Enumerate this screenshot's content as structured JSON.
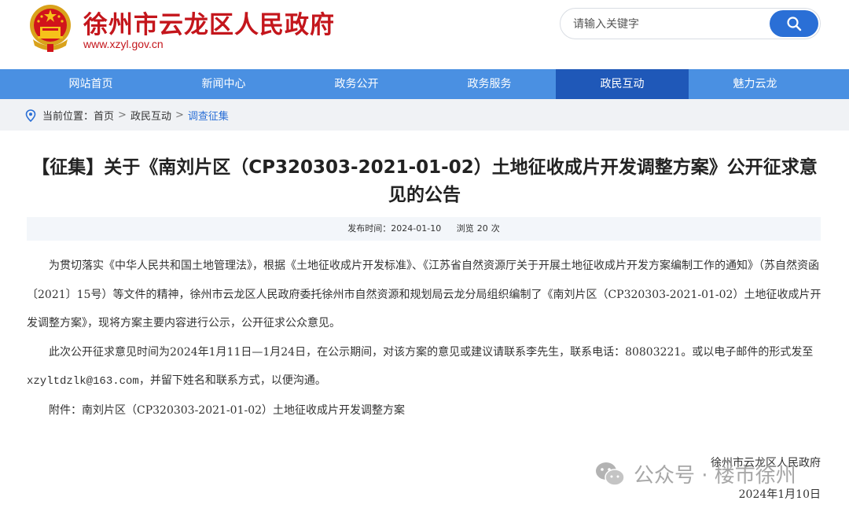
{
  "header": {
    "site_title": "徐州市云龙区人民政府",
    "site_url": "www.xzyl.gov.cn",
    "search_placeholder": "请输入关键字"
  },
  "nav": {
    "items": [
      {
        "label": "网站首页",
        "active": false
      },
      {
        "label": "新闻中心",
        "active": false
      },
      {
        "label": "政务公开",
        "active": false
      },
      {
        "label": "政务服务",
        "active": false
      },
      {
        "label": "政民互动",
        "active": true
      },
      {
        "label": "魅力云龙",
        "active": false
      }
    ]
  },
  "breadcrumb": {
    "prefix": "当前位置：",
    "items": [
      "首页",
      "政民互动",
      "调查征集"
    ],
    "separator": ">"
  },
  "article": {
    "title": "【征集】关于《南刘片区（CP320303-2021-01-02）土地征收成片开发调整方案》公开征求意见的公告",
    "publish_label": "发布时间：",
    "publish_date": "2024-01-10",
    "views_label": "浏览",
    "views": "20",
    "views_unit": "次",
    "para1": "为贯切落实《中华人民共和国土地管理法》，根据《土地征收成片开发标准》、《江苏省自然资源厅关于开展土地征收成片开发方案编制工作的通知》（苏自然资函〔2021〕15号）等文件的精神，徐州市云龙区人民政府委托徐州市自然资源和规划局云龙分局组织编制了《南刘片区（CP320303-2021-01-02）土地征收成片开发调整方案》，现将方案主要内容进行公示，公开征求公众意见。",
    "para2_a": "此次公开征求意见时间为2024年1月11日—1月24日，在公示期间，对该方案的意见或建议请联系李先生，联系电话：80803221。或以电子邮件的形式发至",
    "para2_email": "xzyltdzlk@163.com",
    "para2_b": "，并留下姓名和联系方式，以便沟通。",
    "attachment_label": "附件：",
    "attachment_name": "南刘片区（CP320303-2021-01-02）土地征收成片开发调整方案",
    "signature": "徐州市云龙区人民政府",
    "sign_date": "2024年1月10日"
  },
  "watermark": {
    "text": "公众号 · 楼市徐州"
  },
  "colors": {
    "brand_red": "#c4161c",
    "nav_blue": "#4a90e2",
    "nav_active": "#1f58b8",
    "link_blue": "#2a6fd6"
  }
}
